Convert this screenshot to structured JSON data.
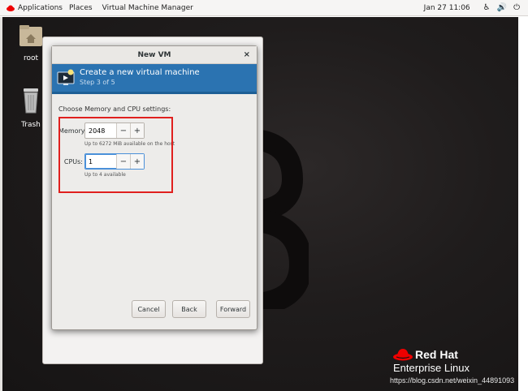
{
  "topbar": {
    "applications": "Applications",
    "places": "Places",
    "app_name": "Virtual Machine Manager",
    "clock": "Jan 27  11:06"
  },
  "desktop": {
    "icons": [
      {
        "label": "root"
      },
      {
        "label": "Trash"
      }
    ],
    "brand_line1": "Red Hat",
    "brand_line2": "Enterprise Linux",
    "watermark": "https://blog.csdn.net/weixin_44891093"
  },
  "dialog": {
    "title": "New VM",
    "close": "×",
    "header_title": "Create a new virtual machine",
    "header_step": "Step 3 of 5",
    "section_label": "Choose Memory and CPU settings:",
    "memory": {
      "label": "Memory:",
      "value": "2048",
      "hint": "Up to 6272 MiB available on the host"
    },
    "cpus": {
      "label": "CPUs:",
      "value": "1",
      "hint": "Up to 4 available"
    },
    "minus": "−",
    "plus": "+",
    "buttons": {
      "cancel": "Cancel",
      "back": "Back",
      "forward": "Forward"
    }
  },
  "colors": {
    "header_blue": "#2b73b1",
    "highlight_red": "#e0201e",
    "redhat_red": "#ee0000"
  }
}
